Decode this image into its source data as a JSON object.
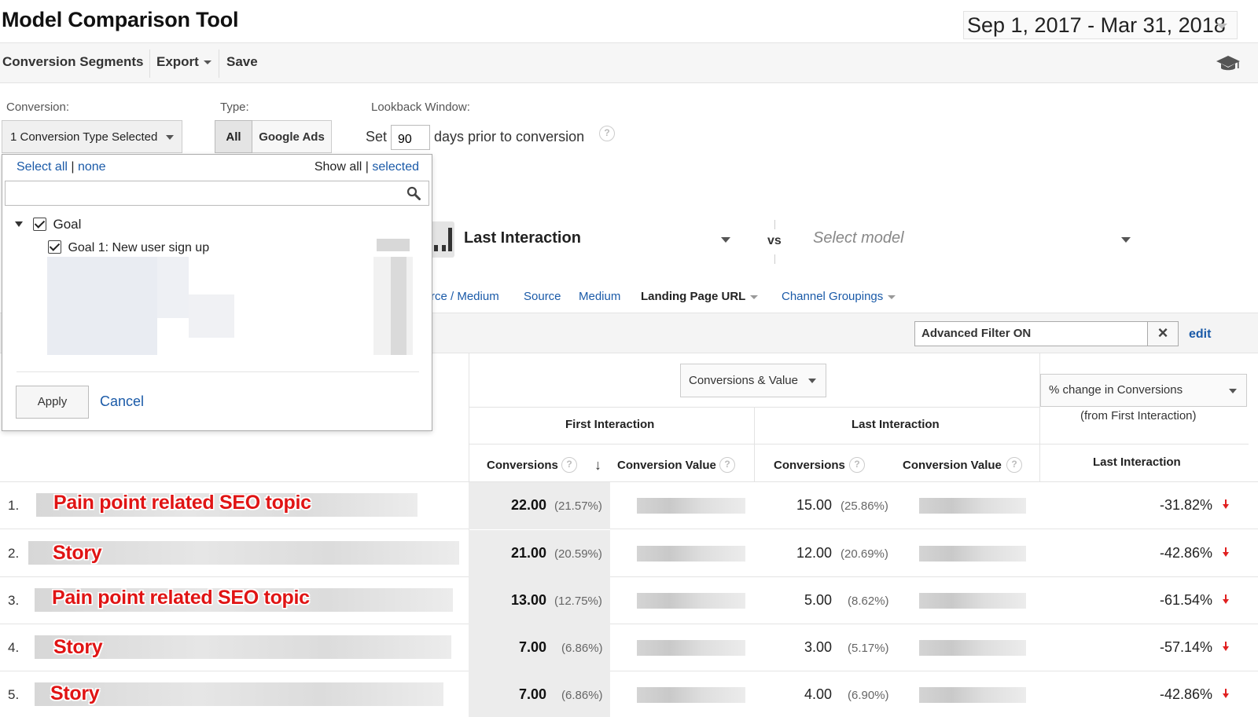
{
  "header": {
    "title": "Model Comparison Tool",
    "date_range": "Sep 1, 2017 - Mar 31, 2018"
  },
  "toolbar": {
    "segments": "Conversion Segments",
    "export": "Export",
    "save": "Save"
  },
  "filters": {
    "conversion_label": "Conversion:",
    "conversion_value": "1 Conversion Type Selected",
    "type_label": "Type:",
    "type_all": "All",
    "type_ads": "Google Ads",
    "lookback_label": "Lookback Window:",
    "lookback_set": "Set",
    "lookback_days": "90",
    "lookback_suffix": "days prior to conversion"
  },
  "dropdown": {
    "select_all": "Select all",
    "sep": "|",
    "none": "none",
    "show_all": "Show all",
    "selected": "selected",
    "group": "Goal",
    "goal_item": "Goal 1: New user sign up",
    "apply": "Apply",
    "cancel": "Cancel"
  },
  "model": {
    "primary": "Last Interaction",
    "vs": "vs",
    "secondary_placeholder": "Select model"
  },
  "dimensions": {
    "source_medium": "rce / Medium",
    "source": "Source",
    "medium": "Medium",
    "landing_page": "Landing Page URL",
    "channel_groupings": "Channel Groupings"
  },
  "filter_bar": {
    "filter_value": "Advanced Filter ON",
    "clear": "×",
    "edit": "edit"
  },
  "table": {
    "metric_select": "Conversions & Value",
    "change_select": "% change in Conversions",
    "change_note": "(from First Interaction)",
    "first_interaction": "First Interaction",
    "last_interaction": "Last Interaction",
    "col_conversions": "Conversions",
    "col_conversion_value": "Conversion Value",
    "col_last_interaction": "Last Interaction",
    "rows": [
      {
        "num": "1.",
        "label": "Pain point related SEO topic",
        "fi": "22.00",
        "fi_pct": "(21.57%)",
        "li": "15.00",
        "li_pct": "(25.86%)",
        "change": "-31.82%"
      },
      {
        "num": "2.",
        "label": "Story",
        "fi": "21.00",
        "fi_pct": "(20.59%)",
        "li": "12.00",
        "li_pct": "(20.69%)",
        "change": "-42.86%"
      },
      {
        "num": "3.",
        "label": "Pain point related SEO topic",
        "fi": "13.00",
        "fi_pct": "(12.75%)",
        "li": "5.00",
        "li_pct": "(8.62%)",
        "change": "-61.54%"
      },
      {
        "num": "4.",
        "label": "Story",
        "fi": "7.00",
        "fi_pct": "(6.86%)",
        "li": "3.00",
        "li_pct": "(5.17%)",
        "change": "-57.14%"
      },
      {
        "num": "5.",
        "label": "Story",
        "fi": "7.00",
        "fi_pct": "(6.86%)",
        "li": "4.00",
        "li_pct": "(6.90%)",
        "change": "-42.86%"
      }
    ]
  },
  "colors": {
    "link": "#1a5aa8",
    "annotation_red": "#e01414",
    "down_arrow": "#e02020"
  },
  "icons": {
    "toolbar_right": "graduation-cap-icon",
    "search": "search-icon",
    "sort": "arrow-down-icon",
    "trend": "red-down-arrow-icon"
  }
}
